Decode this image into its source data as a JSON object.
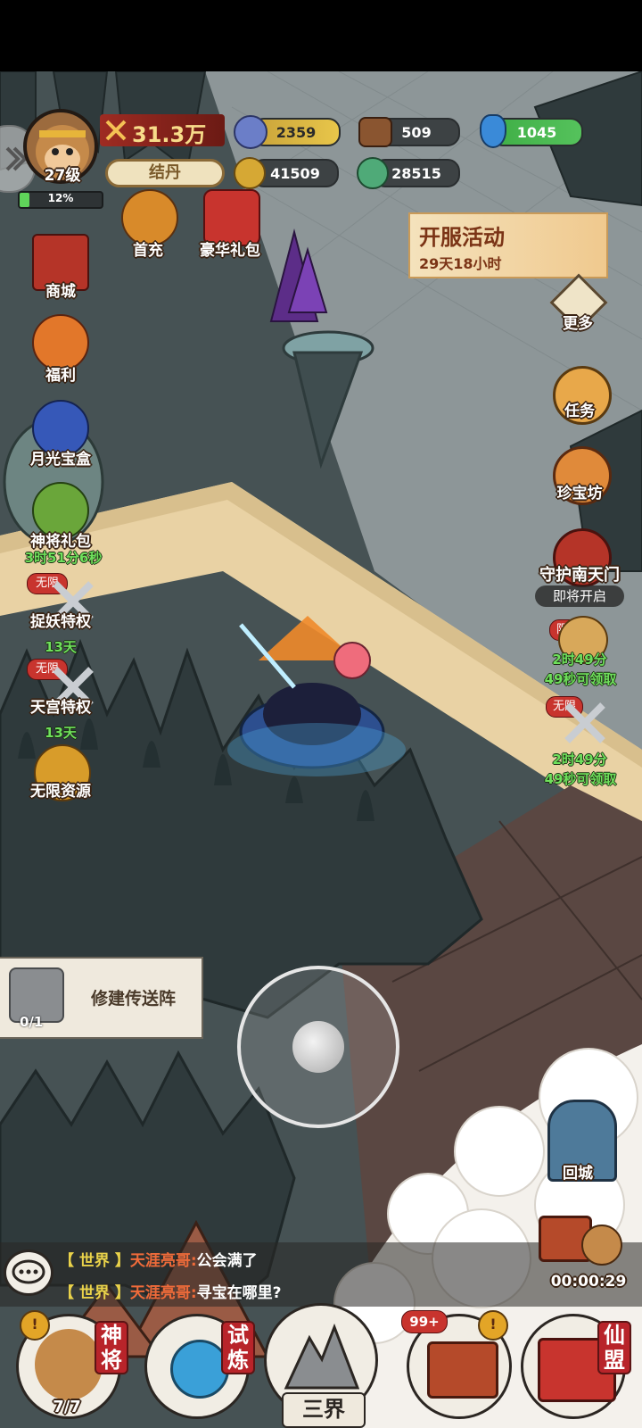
{
  "player": {
    "level": "27级",
    "exp_percent": "12%",
    "exp_fraction": 0.12,
    "power": "31.3万",
    "realm_button": "结丹"
  },
  "resources": {
    "spirit": "2359",
    "wood": "509",
    "gem": "1045",
    "coin": "41509",
    "jade": "28515"
  },
  "top_icons": {
    "first_recharge": "首充",
    "luxury_pack": "豪华礼包"
  },
  "event_banner": {
    "title": "开服活动",
    "time": "29天18小时"
  },
  "left_menu": {
    "shop": "商城",
    "welfare": "福利",
    "moonlight_box": "月光宝盒",
    "general_pack": "神将礼包",
    "general_pack_timer": "3时51分6秒",
    "demon_privilege": "捉妖特权",
    "demon_badge": "无限",
    "demon_days": "13天",
    "palace_privilege": "天宫特权",
    "palace_badge": "无限",
    "palace_days": "13天",
    "unlimited_resources": "无限资源"
  },
  "right_menu": {
    "more": "更多",
    "tasks": "任务",
    "treasure_shop": "珍宝坊",
    "guard_gate": "守护南天门",
    "guard_gate_status": "即将开启",
    "reward1_badge": "限时",
    "reward1_timer_line1": "2时49分",
    "reward1_timer_line2": "49秒可领取",
    "reward2_badge": "无限",
    "reward2_timer_line1": "2时49分",
    "reward2_timer_line2": "49秒可领取",
    "return_city": "回城",
    "chest_timer": "00:00:29"
  },
  "quest": {
    "title": "修建传送阵",
    "progress": "0/1"
  },
  "chat": {
    "messages": [
      {
        "channel": "【 世界 】",
        "name": "天涯亮哥:",
        "text": "公会满了"
      },
      {
        "channel": "【 世界 】",
        "name": "天涯亮哥:",
        "text": "寻宝在哪里?"
      }
    ]
  },
  "bottom_nav": {
    "generals": "神将",
    "generals_count": "7/7",
    "trial": "试炼",
    "three_realms": "三界",
    "treasure_badge": "99+",
    "alliance": "仙盟"
  }
}
